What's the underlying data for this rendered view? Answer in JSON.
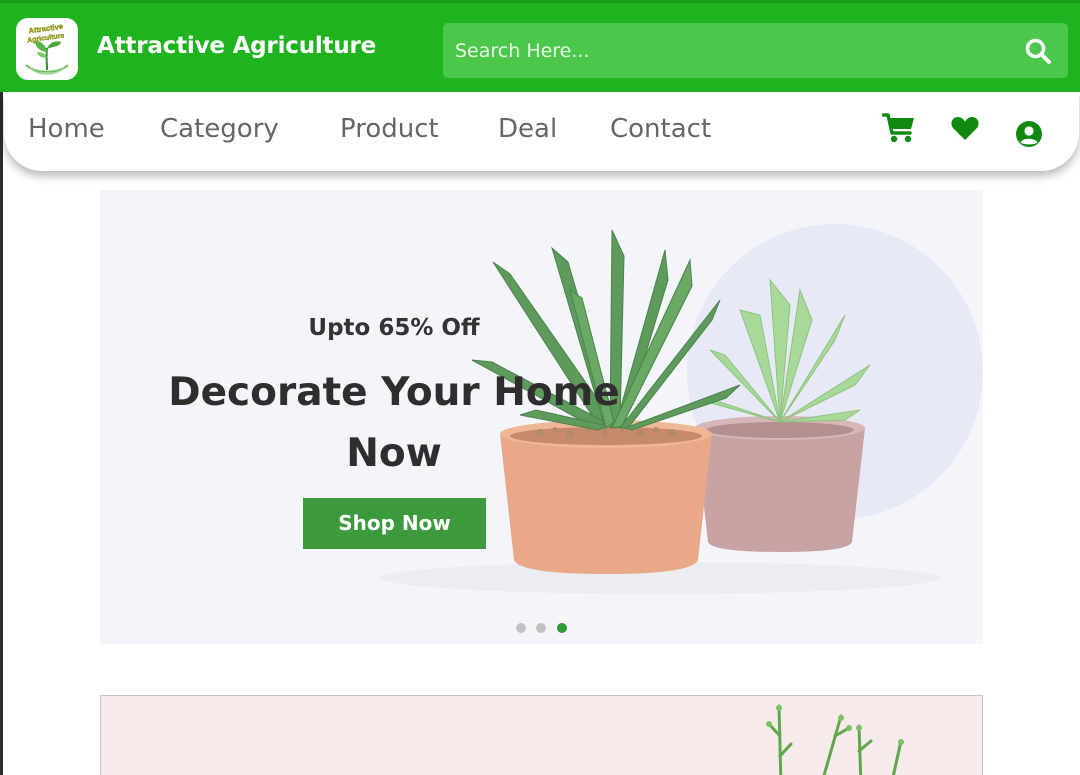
{
  "header": {
    "brand": "Attractive Agriculture",
    "logo_text": "Attractive Agriculture",
    "search_placeholder": "Search Here..."
  },
  "nav": {
    "items": [
      "Home",
      "Category",
      "Product",
      "Deal",
      "Contact"
    ],
    "icons": [
      "cart-icon",
      "heart-icon",
      "user-account-icon"
    ]
  },
  "hero": {
    "eyebrow": "Upto 65% Off",
    "headline": "Decorate Your Home Now",
    "cta": "Shop Now",
    "slides": 3,
    "active_slide": 3
  },
  "colors": {
    "header_green": "#1fb41f",
    "search_green": "#4bc74b",
    "icon_green": "#0f8a0f",
    "cta_green": "#3c9a3c",
    "active_dot": "#2f9a2f"
  }
}
